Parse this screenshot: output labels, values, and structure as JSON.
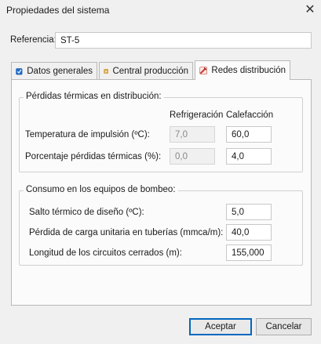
{
  "window": {
    "title": "Propiedades del sistema",
    "close": "✕"
  },
  "reference": {
    "label": "Referencia:",
    "value": "ST-5"
  },
  "tabs": [
    {
      "label": "Datos generales",
      "icon": "checkbox-icon"
    },
    {
      "label": "Central producción",
      "icon": "boiler-icon"
    },
    {
      "label": "Redes distribución",
      "icon": "pipe-tool-icon"
    }
  ],
  "thermal_losses": {
    "title": "Pérdidas térmicas en distribución:",
    "col_refrigeracion": "Refrigeración",
    "col_calefaccion": "Calefacción",
    "rows": [
      {
        "label": "Temperatura de impulsión (ºC):",
        "refrigeracion": "7,0",
        "calefaccion": "60,0"
      },
      {
        "label": "Porcentaje pérdidas térmicas (%):",
        "refrigeracion": "0,0",
        "calefaccion": "4,0"
      }
    ]
  },
  "pumping": {
    "title": "Consumo en los equipos de bombeo:",
    "rows": [
      {
        "label": "Salto térmico de diseño (ºC):",
        "value": "5,0"
      },
      {
        "label": "Pérdida de carga unitaria en tuberías (mmca/m):",
        "value": "40,0"
      },
      {
        "label": "Longitud de los circuitos cerrados (m):",
        "value": "155,000"
      }
    ]
  },
  "buttons": {
    "accept": "Aceptar",
    "cancel": "Cancelar"
  }
}
